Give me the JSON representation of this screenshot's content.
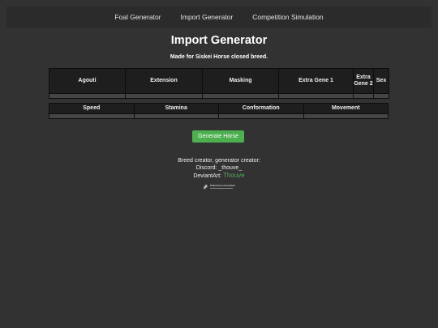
{
  "nav": {
    "items": [
      "Foal Generator",
      "Import Generator",
      "Competition Simulation"
    ]
  },
  "page": {
    "title": "Import Generator",
    "subtitle": "Made for Siskei Horse closed breed."
  },
  "genes_table": {
    "headers": [
      "Agouti",
      "Extension",
      "Masking",
      "Extra Gene 1",
      "Extra Gene 2",
      "Sex"
    ],
    "rows": [
      [
        "",
        "",
        "",
        "",
        "",
        ""
      ]
    ]
  },
  "stats_table": {
    "headers": [
      "Speed",
      "Stamina",
      "Conformation",
      "Movement"
    ],
    "rows": [
      [
        "",
        "",
        "",
        ""
      ]
    ]
  },
  "generate_button": {
    "label": "Generate Horse"
  },
  "credits": {
    "line1": "Breed creator, generator creator:",
    "discord_label": "Discord: ",
    "discord_value": "_thouve_",
    "deviantart_label": "DeviantArt: ",
    "deviantart_link": "Thouve"
  },
  "badge": {
    "text": "Siskei Horse Association",
    "icon": "horse-logo-icon"
  },
  "colors": {
    "background": "#323232",
    "navbar": "#2b2b2b",
    "table_header": "#1e1e1e",
    "table_cell": "#454545",
    "accent": "#4caf50"
  }
}
